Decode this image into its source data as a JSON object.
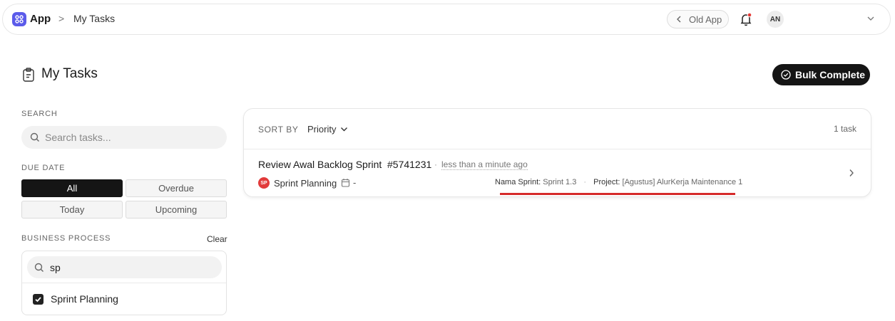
{
  "topbar": {
    "app_name": "App",
    "breadcrumb_separator": ">",
    "current_page": "My Tasks",
    "old_app_label": "Old App",
    "avatar_initials": "AN",
    "notification_dot_color": "#e53935"
  },
  "page": {
    "title": "My Tasks",
    "bulk_complete_label": "Bulk Complete"
  },
  "sidebar": {
    "search_label": "SEARCH",
    "search_placeholder": "Search tasks...",
    "due_date_label": "DUE DATE",
    "due_date_options": [
      "All",
      "Overdue",
      "Today",
      "Upcoming"
    ],
    "due_date_selected": "All",
    "business_process_label": "BUSINESS PROCESS",
    "clear_label": "Clear",
    "bp_search_value": "sp",
    "bp_items": [
      {
        "label": "Sprint Planning",
        "checked": true
      }
    ]
  },
  "tasks_panel": {
    "sort_by_label": "SORT BY",
    "sort_value": "Priority",
    "task_count": "1 task",
    "tasks": [
      {
        "title": "Review Awal Backlog Sprint",
        "id": "#5741231",
        "separator": "·",
        "time": "less than a minute ago",
        "bp_badge": "SP",
        "bp_badge_color": "#e23b3b",
        "bp_name": "Sprint Planning",
        "due": "-",
        "meta": [
          {
            "key": "Nama Sprint:",
            "value": "Sprint 1.3"
          },
          {
            "key": "Project:",
            "value": "[Agustus] AlurKerja Maintenance 1"
          }
        ],
        "meta_separator": "·"
      }
    ]
  },
  "colors": {
    "accent": "#5b5bea",
    "primary_dark": "#151515",
    "highlight_red": "#d62b2b"
  }
}
